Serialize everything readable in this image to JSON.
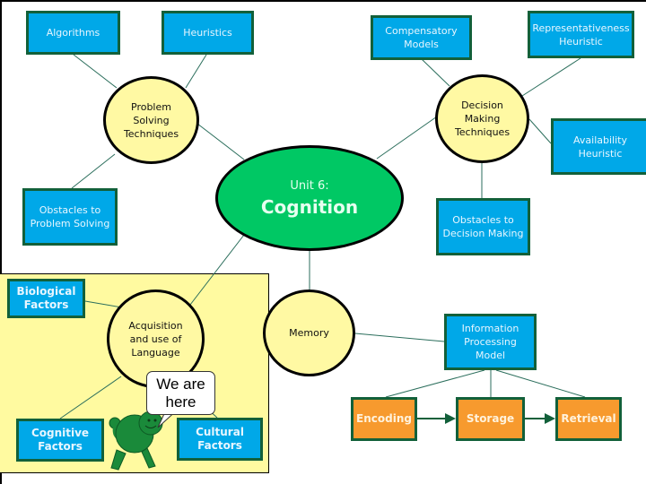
{
  "core": {
    "subtitle": "Unit 6:",
    "title": "Cognition"
  },
  "problem_solving": {
    "label": "Problem\nSolving\nTechniques",
    "children": [
      "Algorithms",
      "Heuristics",
      "Obstacles to\nProblem Solving"
    ]
  },
  "decision_making": {
    "label": "Decision\nMaking\nTechniques",
    "children": [
      "Compensatory\nModels",
      "Representativeness\nHeuristic",
      "Availability\nHeuristic",
      "Obstacles to\nDecision Making"
    ]
  },
  "language": {
    "label": "Acquisition\nand use  of\nLanguage",
    "factors": [
      "Biological\nFactors",
      "Cognitive\nFactors",
      "Cultural\nFactors"
    ]
  },
  "memory": {
    "label": "Memory",
    "model": "Information\nProcessing\nModel",
    "stages": [
      "Encoding",
      "Storage",
      "Retrieval"
    ]
  },
  "marker": {
    "text": "We are\nhere",
    "icon": "turtle-icon"
  },
  "colors": {
    "box_blue": "#00a8e8",
    "box_orange": "#f79a2e",
    "border_green": "#12603a",
    "circle_yellow": "#fff9a3",
    "core_green": "#00c864",
    "highlight_panel": "#fffaa0"
  }
}
